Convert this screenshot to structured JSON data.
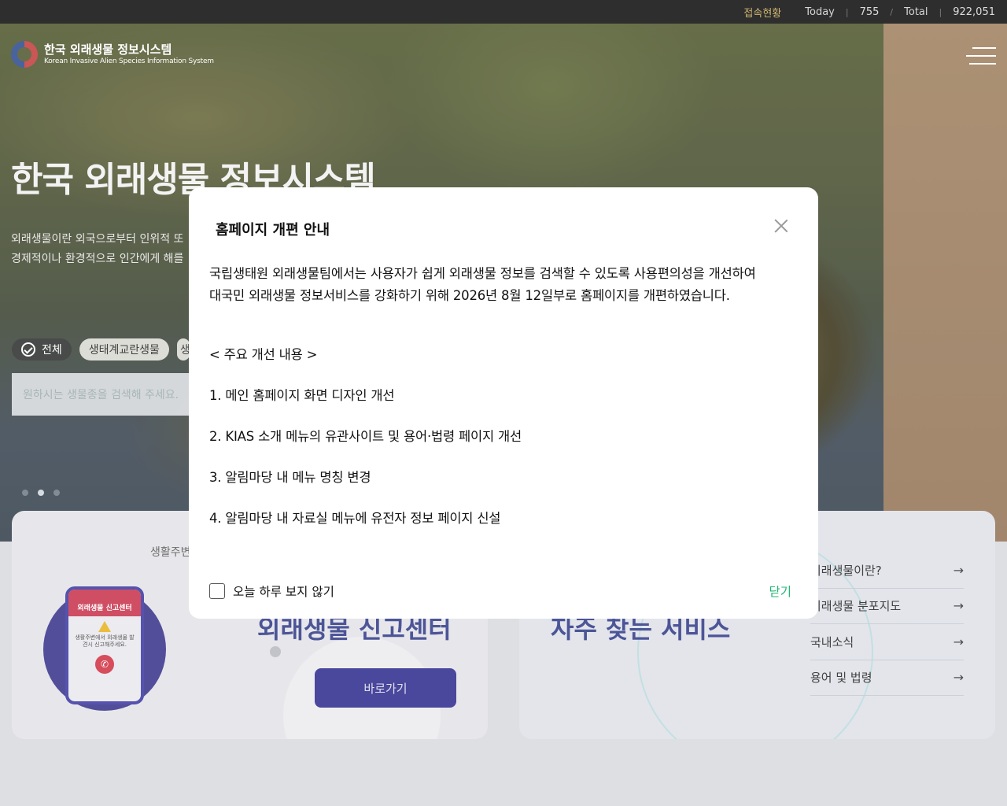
{
  "topbar": {
    "stats_title": "접속현황",
    "today_label": "Today",
    "today_value": "755",
    "divider": "/",
    "total_label": "Total",
    "total_value": "922,051"
  },
  "logo": {
    "title_ko": "한국 외래생물 정보시스템",
    "title_en": "Korean Invasive Alien Species Information System"
  },
  "hero": {
    "title": "한국 외래생물 정보시스템",
    "desc_line1": "외래생물이란 외국으로부터 인위적 또",
    "desc_line2": "경제적이나 환경적으로 인간에게 해를"
  },
  "filters": {
    "all_label": "전체",
    "ecosys_label": "생태계교란생물",
    "cut_label": "생"
  },
  "search": {
    "placeholder": "원하시는 생물종을 검색해 주세요."
  },
  "report_card": {
    "life_label": "생활주변",
    "title": "외래생물 신고센터",
    "go_button": "바로가기",
    "phone_header": "외래생물 신고센터",
    "phone_msg": "생활주변에서 외래생물 발견시 신고해주세요."
  },
  "service_card": {
    "title": "자주 찾는 서비스",
    "items": [
      {
        "label": "외래생물이란?"
      },
      {
        "label": "외래생물 분포지도"
      },
      {
        "label": "국내소식"
      },
      {
        "label": "용어 및 법령"
      }
    ]
  },
  "modal": {
    "title": "홈페이지 개편 안내",
    "para_line1": "국립생태원 외래생물팀에서는 사용자가 쉽게 외래생물 정보를 검색할 수 있도록 사용편의성을 개선하여",
    "para_line2": "대국민 외래생물 정보서비스를 강화하기 위해 2026년 8월 12일부로 홈페이지를 개편하였습니다.",
    "section_heading": "< 주요 개선 내용 >",
    "items": [
      "1. 메인 홈페이지 화면 디자인 개선",
      "2. KIAS 소개 메뉴의 유관사이트 및 용어·법령 페이지 개선",
      "3. 알림마당 내 메뉴 명칭 변경",
      "4. 알림마당 내 자료실 메뉴에 유전자 정보 페이지 신설"
    ],
    "dont_show_today": "오늘 하루 보지 않기",
    "close_label": "닫기"
  }
}
